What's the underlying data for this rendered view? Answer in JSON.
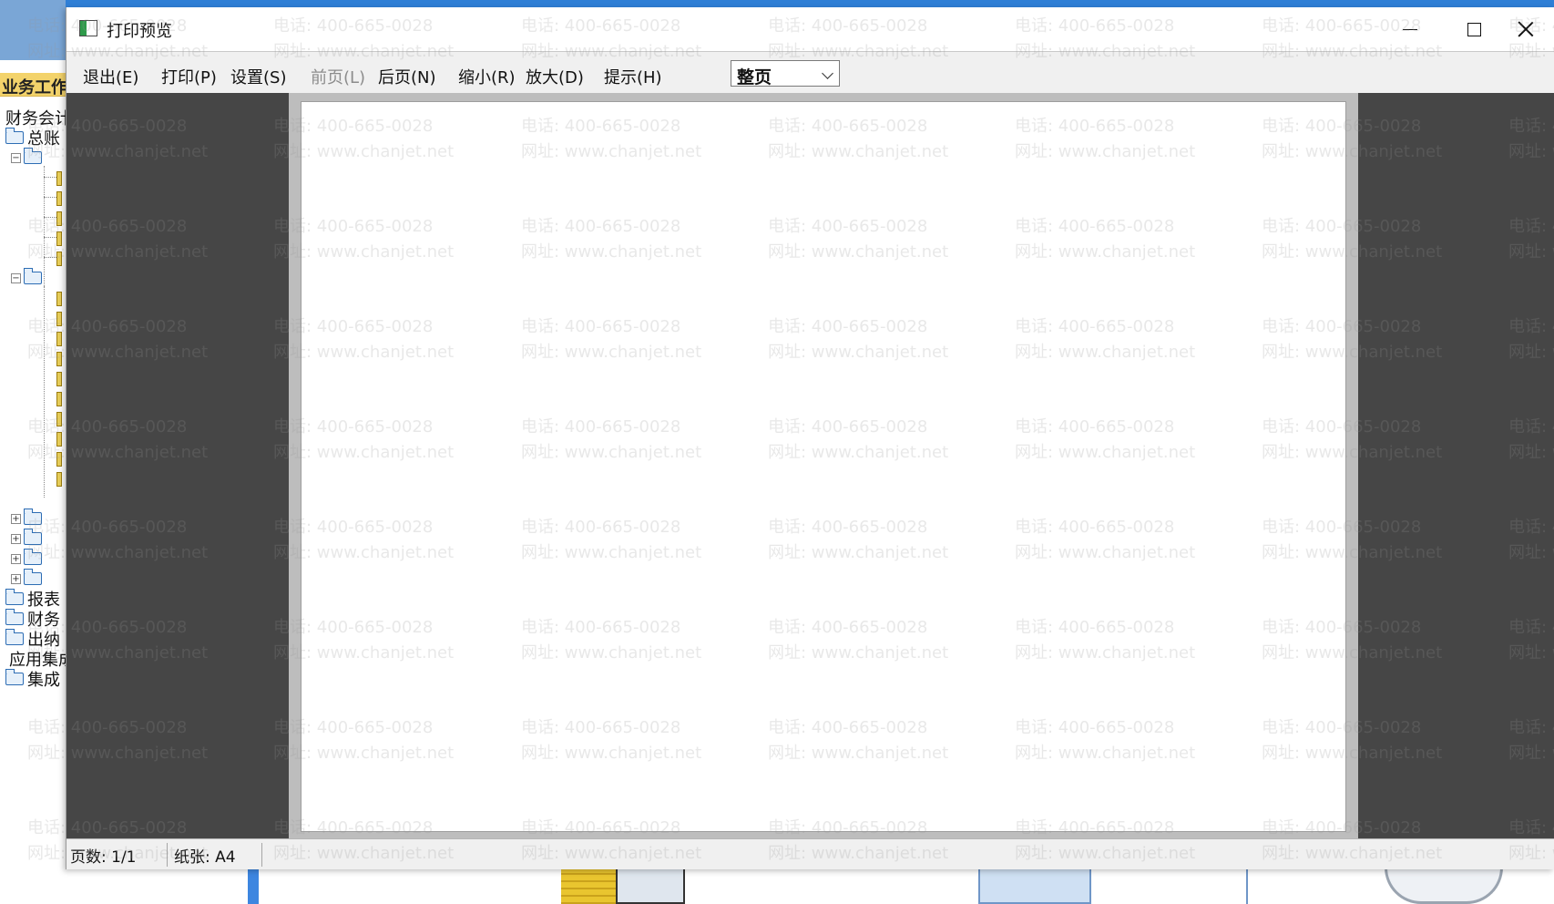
{
  "window": {
    "title": "打印预览",
    "minimize_label": "",
    "maximize_label": "",
    "close_label": ""
  },
  "toolbar": {
    "exit": "退出(E)",
    "print": "打印(P)",
    "setup": "设置(S)",
    "prev_page": "前页(L)",
    "next_page": "后页(N)",
    "zoom_out": "缩小(R)",
    "zoom_in": "放大(D)",
    "hint": "提示(H)",
    "zoom_mode": {
      "selected": "整页"
    }
  },
  "statusbar": {
    "pages": "页数: 1/1",
    "paper": "纸张: A4"
  },
  "background_app": {
    "tab_header": "业务工作",
    "tree": {
      "root": "财务会计",
      "ledger": "总账",
      "reports": "报表",
      "finance": "财务",
      "cashier": "出纳",
      "apps_group": "应用集成",
      "integration": "集成"
    }
  },
  "watermark": {
    "phone": "电话: 400-665-0028",
    "website": "网址: www.chanjet.net"
  },
  "colors": {
    "toolbar_bg": "#f0f0f0",
    "viewport_bg": "#464646",
    "page_frame": "#bdbdbd"
  }
}
